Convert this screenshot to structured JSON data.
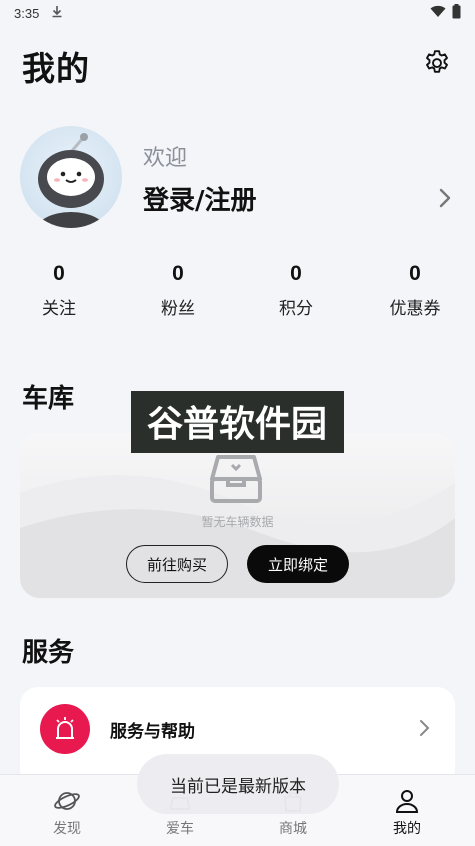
{
  "status_bar": {
    "time": "3:35"
  },
  "header": {
    "title": "我的"
  },
  "profile": {
    "welcome": "欢迎",
    "login_label": "登录/注册"
  },
  "stats": [
    {
      "value": "0",
      "label": "关注"
    },
    {
      "value": "0",
      "label": "粉丝"
    },
    {
      "value": "0",
      "label": "积分"
    },
    {
      "value": "0",
      "label": "优惠券"
    }
  ],
  "garage": {
    "title": "车库",
    "empty_text": "暂无车辆数据",
    "buy_label": "前往购买",
    "bind_label": "立即绑定"
  },
  "watermark": {
    "text": "谷普软件园"
  },
  "services": {
    "title": "服务",
    "items": [
      {
        "label": "服务与帮助",
        "icon": "siren-icon",
        "color": "#e8194f"
      }
    ]
  },
  "tabs": [
    {
      "label": "发现",
      "icon": "planet-icon"
    },
    {
      "label": "爱车",
      "icon": "car-icon"
    },
    {
      "label": "商城",
      "icon": "bag-icon"
    },
    {
      "label": "我的",
      "icon": "person-icon",
      "active": true
    }
  ],
  "toast": {
    "message": "当前已是最新版本"
  }
}
